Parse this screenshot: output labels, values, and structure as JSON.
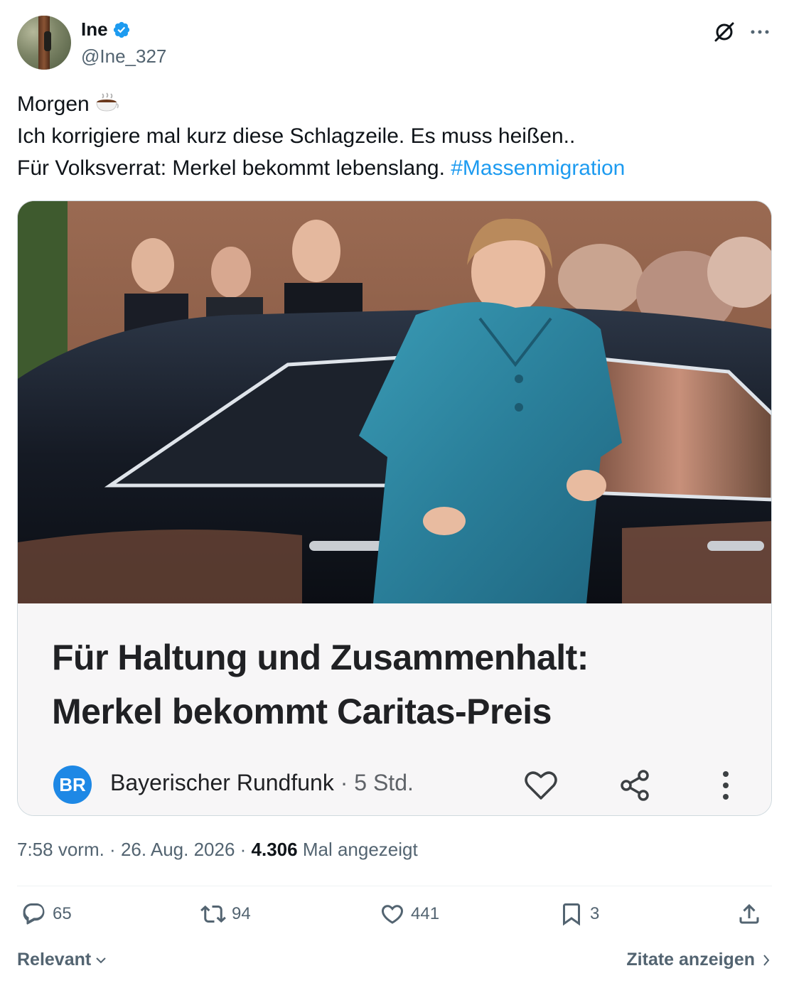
{
  "author": {
    "name": "Ine",
    "handle": "@Ine_327"
  },
  "tweet": {
    "lines": [
      "Morgen",
      "Ich korrigiere mal kurz diese Schlagzeile. Es muss heißen..",
      "Für Volksverrat: Merkel bekommt lebenslang. "
    ],
    "hashtag": "#Massenmigration"
  },
  "card": {
    "headline_line1": "Für Haltung und Zusammenhalt:",
    "headline_line2": "Merkel bekommt Caritas-Preis",
    "source": "Bayerischer Rundfunk",
    "age": " · 5 Std."
  },
  "meta": {
    "time": "7:58 vorm.",
    "date": "26. Aug. 2026",
    "views_count": "4.306",
    "views_label": "Mal angezeigt"
  },
  "actions": {
    "replies": "65",
    "reposts": "94",
    "likes": "441",
    "bookmarks": "3"
  },
  "footer": {
    "sort": "Relevant",
    "quotes": "Zitate anzeigen"
  },
  "colors": {
    "accent": "#1d9bf0",
    "muted": "#536471",
    "text": "#0f1419",
    "br_blue": "#1e88e5"
  },
  "icons": [
    "verified-icon",
    "grok-icon",
    "more-icon",
    "coffee-icon",
    "br-logo",
    "heart-icon",
    "share-icon",
    "kebab-icon",
    "reply-icon",
    "repost-icon",
    "like-icon",
    "bookmark-icon",
    "share-upload-icon",
    "chevron-down-icon",
    "chevron-right-icon"
  ]
}
